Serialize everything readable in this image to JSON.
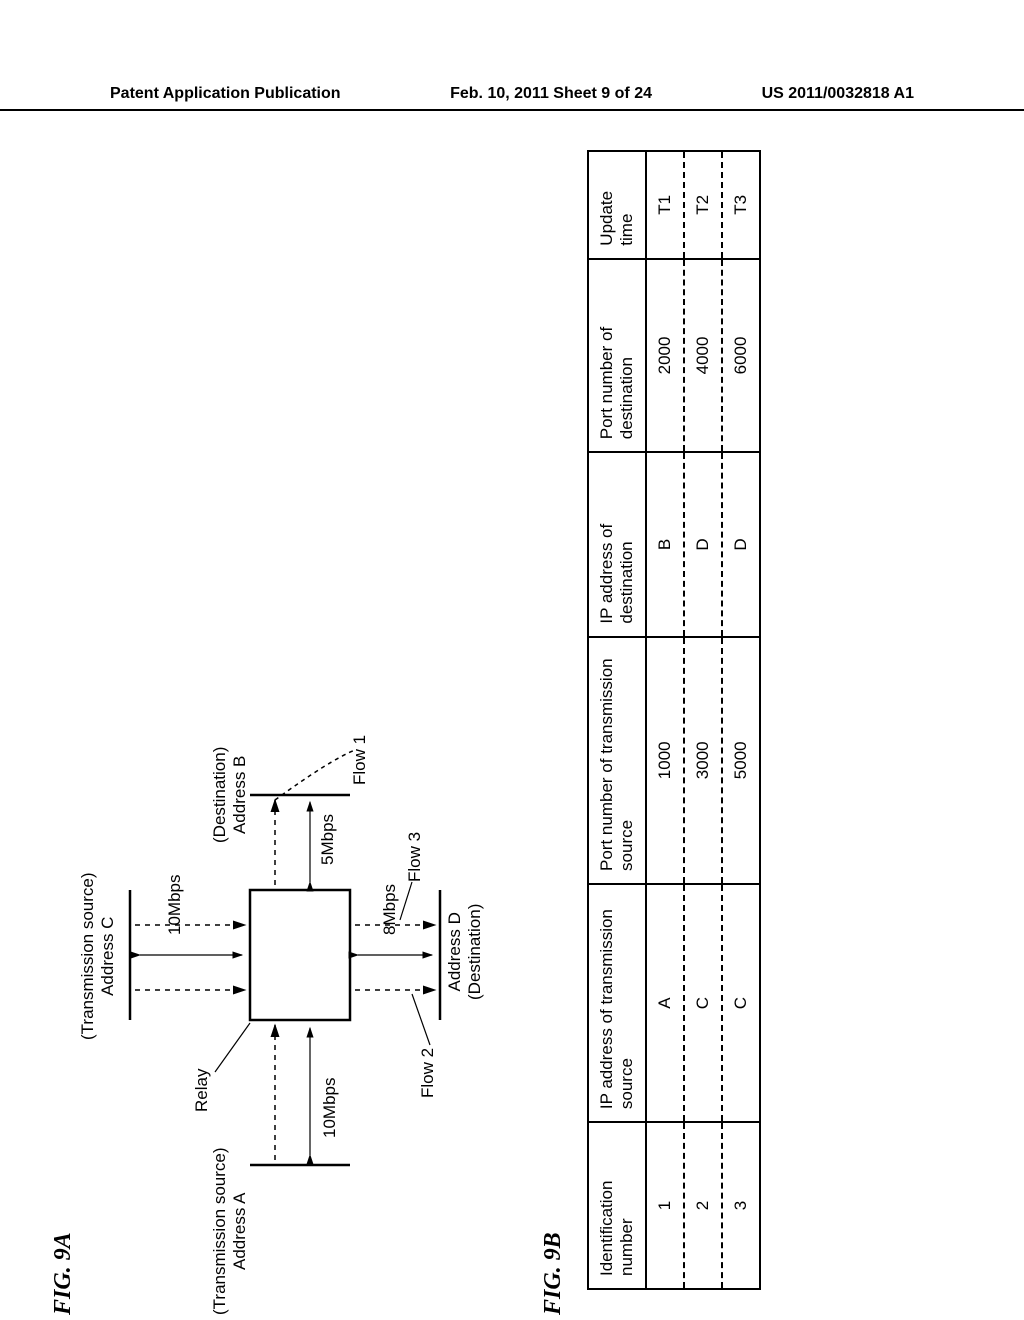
{
  "header": {
    "left": "Patent Application Publication",
    "center": "Feb. 10, 2011  Sheet 9 of 24",
    "right": "US 2011/0032818 A1"
  },
  "fig9a": {
    "label": "FIG. 9A",
    "tx_source_a_title": "(Transmission source)",
    "tx_source_a_addr": "Address A",
    "tx_source_c_title": "(Transmission source)",
    "tx_source_c_addr": "Address C",
    "dest_b_title": "(Destination)",
    "dest_b_addr": "Address B",
    "dest_d_addr": "Address D",
    "dest_d_title": "(Destination)",
    "relay": "Relay",
    "rate_10_1": "10Mbps",
    "rate_10_2": "10Mbps",
    "rate_5": "5Mbps",
    "rate_8": "8Mbps",
    "flow1": "Flow 1",
    "flow2": "Flow 2",
    "flow3": "Flow 3"
  },
  "fig9b": {
    "label": "FIG. 9B",
    "headers": {
      "id": "Identification number",
      "src_ip": "IP address of transmission source",
      "src_port": "Port number of transmission source",
      "dst_ip": "IP address of destination",
      "dst_port": "Port number of destination",
      "update": "Update time"
    },
    "rows": [
      {
        "id": "1",
        "src_ip": "A",
        "src_port": "1000",
        "dst_ip": "B",
        "dst_port": "2000",
        "update": "T1"
      },
      {
        "id": "2",
        "src_ip": "C",
        "src_port": "3000",
        "dst_ip": "D",
        "dst_port": "4000",
        "update": "T2"
      },
      {
        "id": "3",
        "src_ip": "C",
        "src_port": "5000",
        "dst_ip": "D",
        "dst_port": "6000",
        "update": "T3"
      }
    ]
  }
}
